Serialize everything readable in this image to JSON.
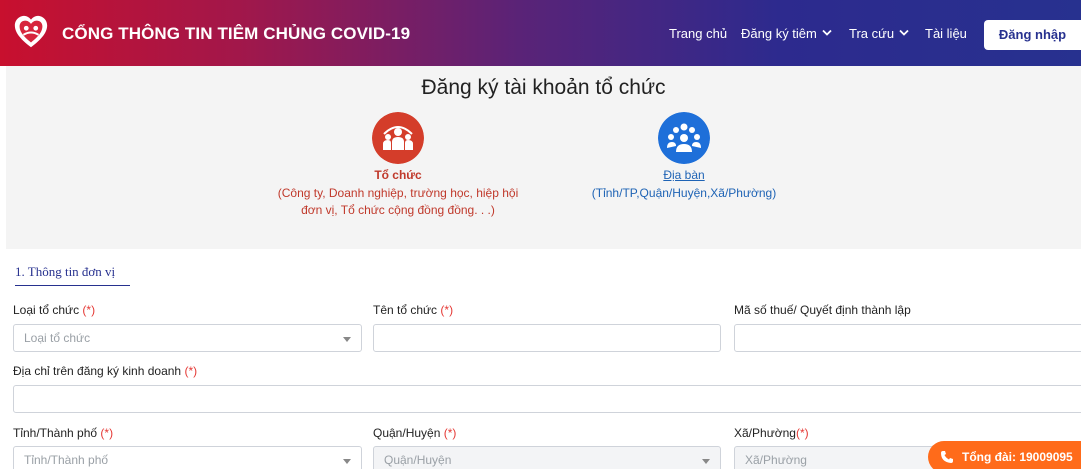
{
  "header": {
    "title": "CỔNG THÔNG TIN TIÊM CHỦNG COVID-19",
    "logo_icon": "heart-shield-logo",
    "nav": [
      {
        "label": "Trang chủ",
        "dropdown": false
      },
      {
        "label": "Đăng ký tiêm",
        "dropdown": true
      },
      {
        "label": "Tra cứu",
        "dropdown": true
      },
      {
        "label": "Tài liệu",
        "dropdown": false
      }
    ],
    "login_label": "Đăng nhập"
  },
  "hero": {
    "title": "Đăng ký tài khoản tổ chức",
    "options": [
      {
        "name": "Tổ chức",
        "desc_line1": "(Công ty, Doanh nghiệp, trường học, hiệp hội",
        "desc_line2": "đơn vị, Tổ chức cộng đồng đồng. . .)",
        "icon": "organization-icon",
        "color": "#d43d2a"
      },
      {
        "name": "Địa bàn",
        "desc_line1": "(Tỉnh/TP,Quận/Huyện,Xã/Phường)",
        "desc_line2": "",
        "icon": "community-icon",
        "color": "#1e6fd9"
      }
    ]
  },
  "form": {
    "section_title": "1. Thông tin đơn vị",
    "required_mark": "(*)",
    "org_type": {
      "label": "Loại tổ chức",
      "placeholder": "Loại tổ chức"
    },
    "org_name": {
      "label": "Tên tổ chức",
      "value": ""
    },
    "tax_code": {
      "label": "Mã số thuế/ Quyết định thành lập",
      "value": ""
    },
    "address": {
      "label": "Địa chỉ trên đăng ký kinh doanh",
      "value": ""
    },
    "province": {
      "label": "Tỉnh/Thành phố",
      "placeholder": "Tỉnh/Thành phố"
    },
    "district": {
      "label": "Quận/Huyện",
      "placeholder": "Quận/Huyện"
    },
    "ward": {
      "label": "Xã/Phường",
      "placeholder": "Xã/Phường"
    }
  },
  "hotline": {
    "label": "Tổng đài: 19009095",
    "icon": "phone-icon"
  },
  "colors": {
    "primary": "#27318f",
    "accent_red": "#c8102e",
    "hotline": "#ff6b1a"
  }
}
